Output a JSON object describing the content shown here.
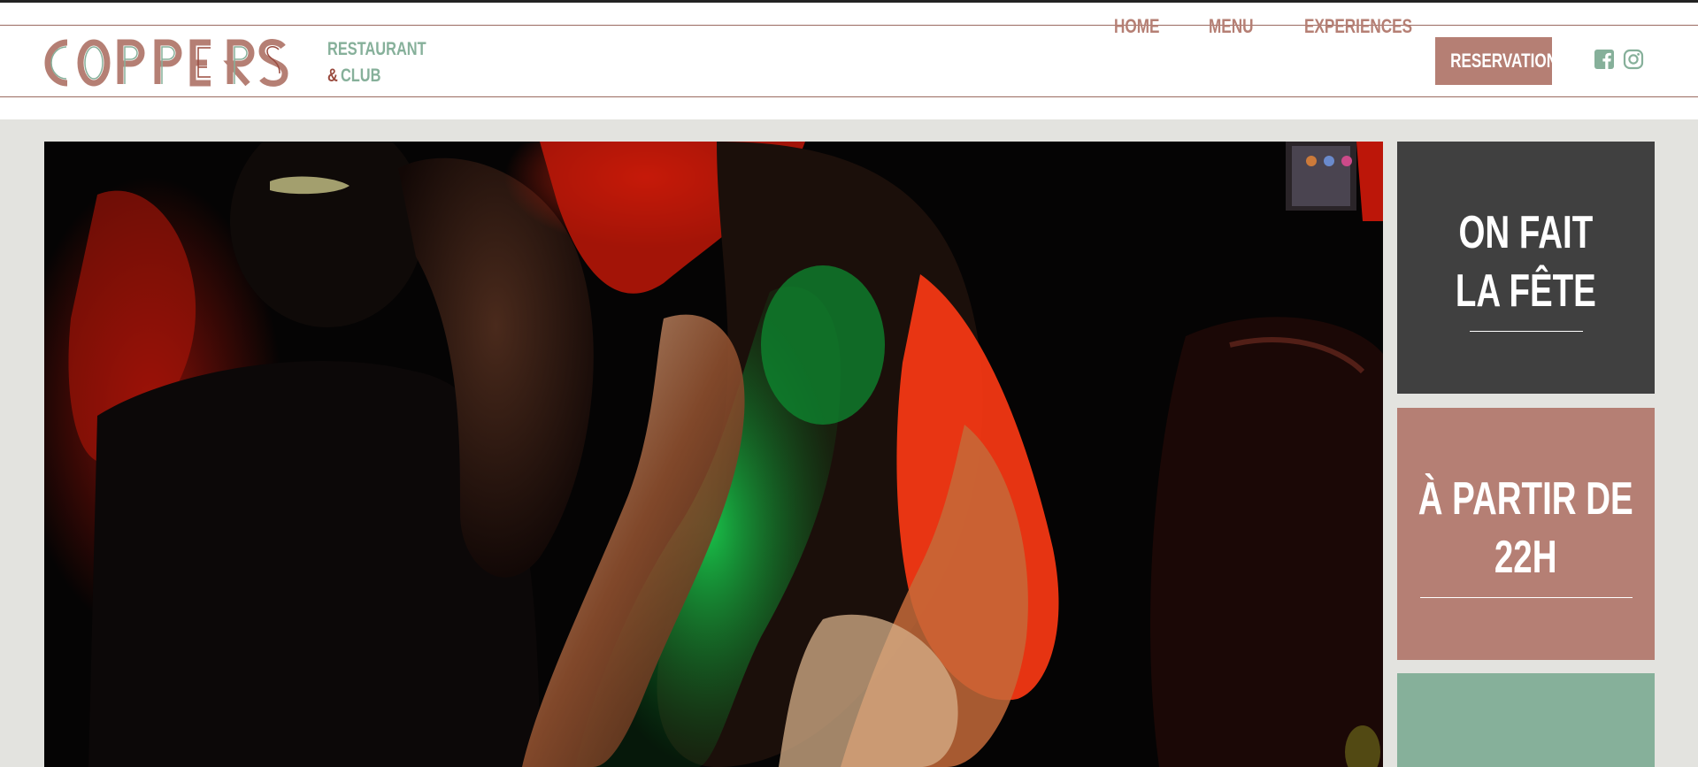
{
  "brand": {
    "name": "COPPERS",
    "sub_amp": "&",
    "sub_line1": "RESTAURANT",
    "sub_line2": "CLUB",
    "colors": {
      "copper": "#b57f74",
      "sage": "#86b09a",
      "burgundy": "#9a4b3f"
    }
  },
  "nav": {
    "items": [
      {
        "label": "HOME"
      },
      {
        "label": "MENU"
      },
      {
        "label": "EXPERIENCES"
      }
    ],
    "reservation_label": "RESERVATION"
  },
  "social": {
    "icons": [
      "facebook-icon",
      "instagram-icon"
    ]
  },
  "hero": {
    "image": "dancing-crowd-photo"
  },
  "tiles": [
    {
      "line1": "ON FAIT",
      "line2": "LA FÊTE",
      "bg": "#404040"
    },
    {
      "line1": "À PARTIR DE",
      "line2": "22H",
      "bg": "#b57f74"
    },
    {
      "bg": "#86b09a"
    }
  ]
}
